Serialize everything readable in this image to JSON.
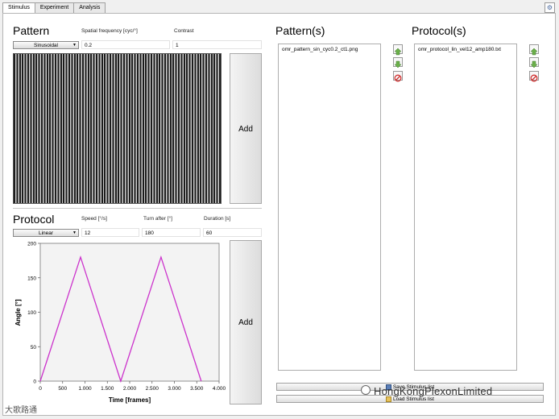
{
  "tabs": [
    "Stimulus",
    "Experiment",
    "Analysis"
  ],
  "pattern": {
    "title": "Pattern",
    "spatial_frequency_label": "Spatial frequency [cyc/°]",
    "spatial_frequency_value": "0.2",
    "contrast_label": "Contrast",
    "contrast_value": "1",
    "type_selected": "Sinusoidal",
    "add_label": "Add"
  },
  "protocol": {
    "title": "Protocol",
    "speed_label": "Speed [°/s]",
    "speed_value": "12",
    "turn_after_label": "Turn after [°]",
    "turn_after_value": "180",
    "duration_label": "Duration [s]",
    "duration_value": "60",
    "type_selected": "Linear",
    "add_label": "Add"
  },
  "patterns_list": {
    "title": "Pattern(s)",
    "items": [
      "omr_pattern_sin_cyc0.2_ct1.png"
    ]
  },
  "protocols_list": {
    "title": "Protocol(s)",
    "items": [
      "omr_protocol_lin_vel12_amp180.txt"
    ]
  },
  "buttons": {
    "save_stimulus": "Save Stimulus list",
    "load_stimulus": "Load Stimulus list"
  },
  "watermarks": {
    "left": "大歌路通",
    "right": "HongKongPlexonLimited"
  },
  "chart_data": {
    "type": "line",
    "xlabel": "Time [frames]",
    "ylabel": "Angle [°]",
    "xlim": [
      0,
      4000
    ],
    "ylim": [
      0,
      200
    ],
    "xticks": [
      "0",
      "500",
      "1.000",
      "1.500",
      "2.000",
      "2.500",
      "3.000",
      "3.500",
      "4.000"
    ],
    "yticks": [
      "0",
      "50",
      "100",
      "150",
      "200"
    ],
    "grid": false,
    "color": "#cc33cc",
    "x": [
      0,
      900,
      1800,
      2700,
      3600
    ],
    "y": [
      0,
      180,
      0,
      180,
      0
    ]
  }
}
